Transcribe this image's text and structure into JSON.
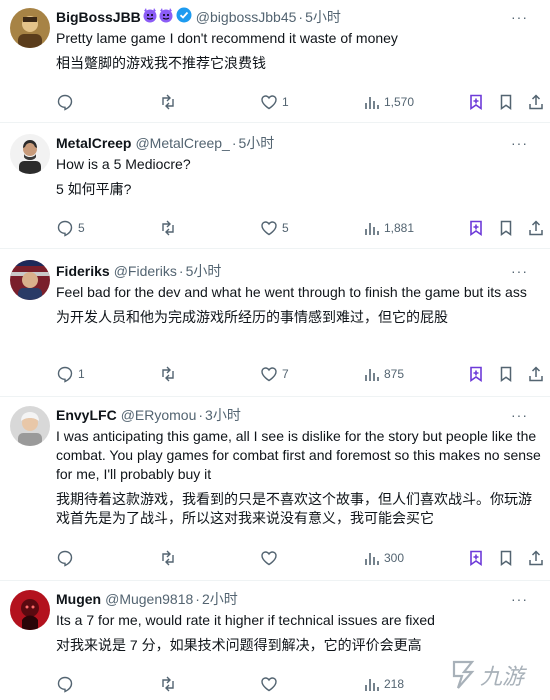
{
  "tweets": [
    {
      "name": "BigBossJBB",
      "emojis": "😈😈",
      "verified": true,
      "handle": "@bigbossJbb45",
      "dot": "·",
      "time": "5小时",
      "more": "···",
      "lines": [
        "Pretty lame game I don't recommend it waste of money",
        "相当蹩脚的游戏我不推荐它浪费钱"
      ],
      "replies": "",
      "retweets": "",
      "likes": "1",
      "views": "1,570"
    },
    {
      "name": "MetalCreep",
      "handle": "@MetalCreep_",
      "dot": "·",
      "time": "5小时",
      "more": "···",
      "lines": [
        "How is a 5 Mediocre?",
        "5 如何平庸?"
      ],
      "replies": "5",
      "retweets": "",
      "likes": "5",
      "views": "1,881"
    },
    {
      "name": "Fideriks",
      "handle": "@Fideriks",
      "dot": "·",
      "time": "5小时",
      "more": "···",
      "lines": [
        "Feel bad for the dev and what he went through to finish the game but its ass",
        "为开发人员和他为完成游戏所经历的事情感到难过，但它的屁股"
      ],
      "replies": "1",
      "retweets": "",
      "likes": "7",
      "views": "875"
    },
    {
      "name": "EnvyLFC",
      "handle": "@ERyomou",
      "dot": "·",
      "time": "3小时",
      "more": "···",
      "lines": [
        "I was anticipating this game, all I see is dislike for the story but people like the combat. You play games for combat first and foremost so this makes no sense for me, I'll probably buy it",
        "我期待着这款游戏，我看到的只是不喜欢这个故事，但人们喜欢战斗。你玩游戏首先是为了战斗，所以这对我来说没有意义，我可能会买它"
      ],
      "replies": "",
      "retweets": "",
      "likes": "",
      "views": "300"
    },
    {
      "name": "Mugen",
      "handle": "@Mugen9818",
      "dot": "·",
      "time": "2小时",
      "more": "···",
      "lines": [
        "Its a 7 for me, would rate it higher if technical issues are fixed",
        "对我来说是 7 分，如果技术问题得到解决，它的评价会更高"
      ],
      "replies": "",
      "retweets": "",
      "likes": "",
      "views": "218"
    }
  ],
  "watermark": "九游",
  "colors": {
    "text": "#0f1419",
    "muted": "#536471",
    "verified": "#1d9bf0",
    "grok": "#6e3bd8",
    "divider": "#eff3f4"
  }
}
